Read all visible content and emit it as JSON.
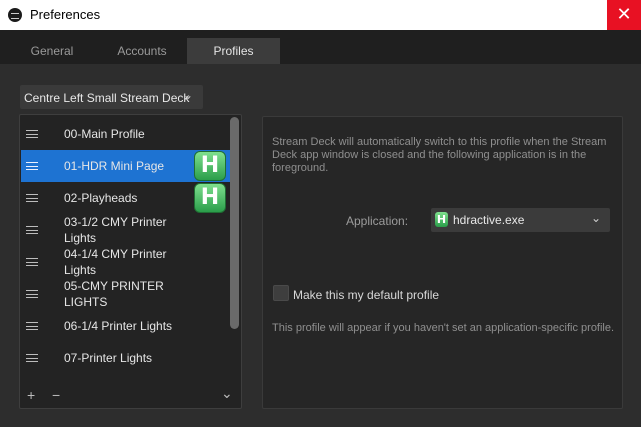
{
  "window": {
    "title": "Preferences",
    "close_glyph": "✕",
    "icon": "stream-deck-app-icon"
  },
  "tabs": [
    {
      "label": "General",
      "active": false
    },
    {
      "label": "Accounts",
      "active": false
    },
    {
      "label": "Profiles",
      "active": true
    }
  ],
  "device_select": {
    "value": "Centre Left Small Stream Deck",
    "chevron": "⌄"
  },
  "profiles": [
    {
      "name": "00-Main Profile",
      "selected": false
    },
    {
      "name": "01-HDR Mini Page",
      "selected": true
    },
    {
      "name": "02-Playheads",
      "selected": false
    },
    {
      "name": "03-1/2 CMY Printer Lights",
      "selected": false
    },
    {
      "name": "04-1/4 CMY Printer Lights",
      "selected": false
    },
    {
      "name": "05-CMY PRINTER LIGHTS",
      "selected": false
    },
    {
      "name": "06-1/4 Printer Lights",
      "selected": false
    },
    {
      "name": "07-Printer Lights",
      "selected": false
    }
  ],
  "app_icon_letter": "H",
  "list_footer": {
    "add": "+",
    "remove": "−",
    "more": "⌄"
  },
  "detail": {
    "description": "Stream Deck will automatically switch to this profile when the Stream Deck app window is closed and the following application is in the foreground.",
    "application_label": "Application:",
    "application_value": "hdractive.exe",
    "application_chevron": "⌄",
    "default_checkbox_label": "Make this my default profile",
    "default_checked": false,
    "hint": "This profile will appear if you haven't set an application-specific profile."
  },
  "colors": {
    "accent": "#1e73d2",
    "close": "#e81123",
    "app_icon": "#3cb454"
  }
}
